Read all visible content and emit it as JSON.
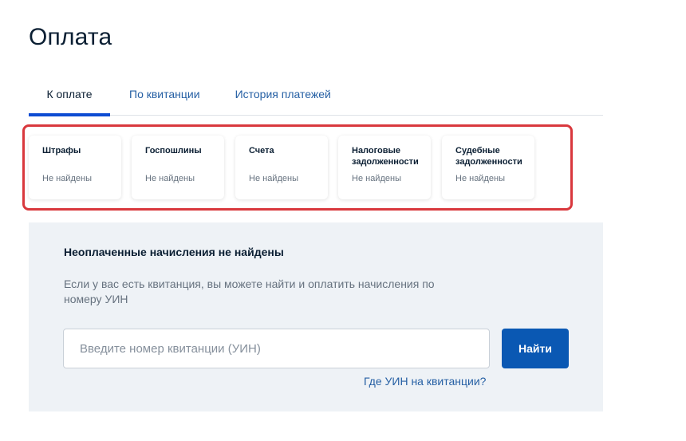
{
  "page_title": "Оплата",
  "tabs": [
    {
      "label": "К оплате",
      "active": true
    },
    {
      "label": "По квитанции",
      "active": false
    },
    {
      "label": "История платежей",
      "active": false
    }
  ],
  "categories": [
    {
      "title": "Штрафы",
      "status": "Не найдены"
    },
    {
      "title": "Госпошлины",
      "status": "Не найдены"
    },
    {
      "title": "Счета",
      "status": "Не найдены"
    },
    {
      "title": "Налоговые задолженности",
      "status": "Не найдены"
    },
    {
      "title": "Судебные задолженности",
      "status": "Не найдены"
    }
  ],
  "panel": {
    "heading": "Неоплаченные начисления не найдены",
    "text": "Если у вас есть квитанция, вы можете найти и оплатить начисления по номеру УИН",
    "search_placeholder": "Введите номер квитанции (УИН)",
    "search_value": "",
    "find_button_label": "Найти",
    "help_link": "Где УИН на квитанции?"
  },
  "colors": {
    "accent": "#0d4cd3",
    "button": "#0a58b3",
    "highlight_frame": "#d9383d",
    "panel_bg": "#eef2f6"
  }
}
